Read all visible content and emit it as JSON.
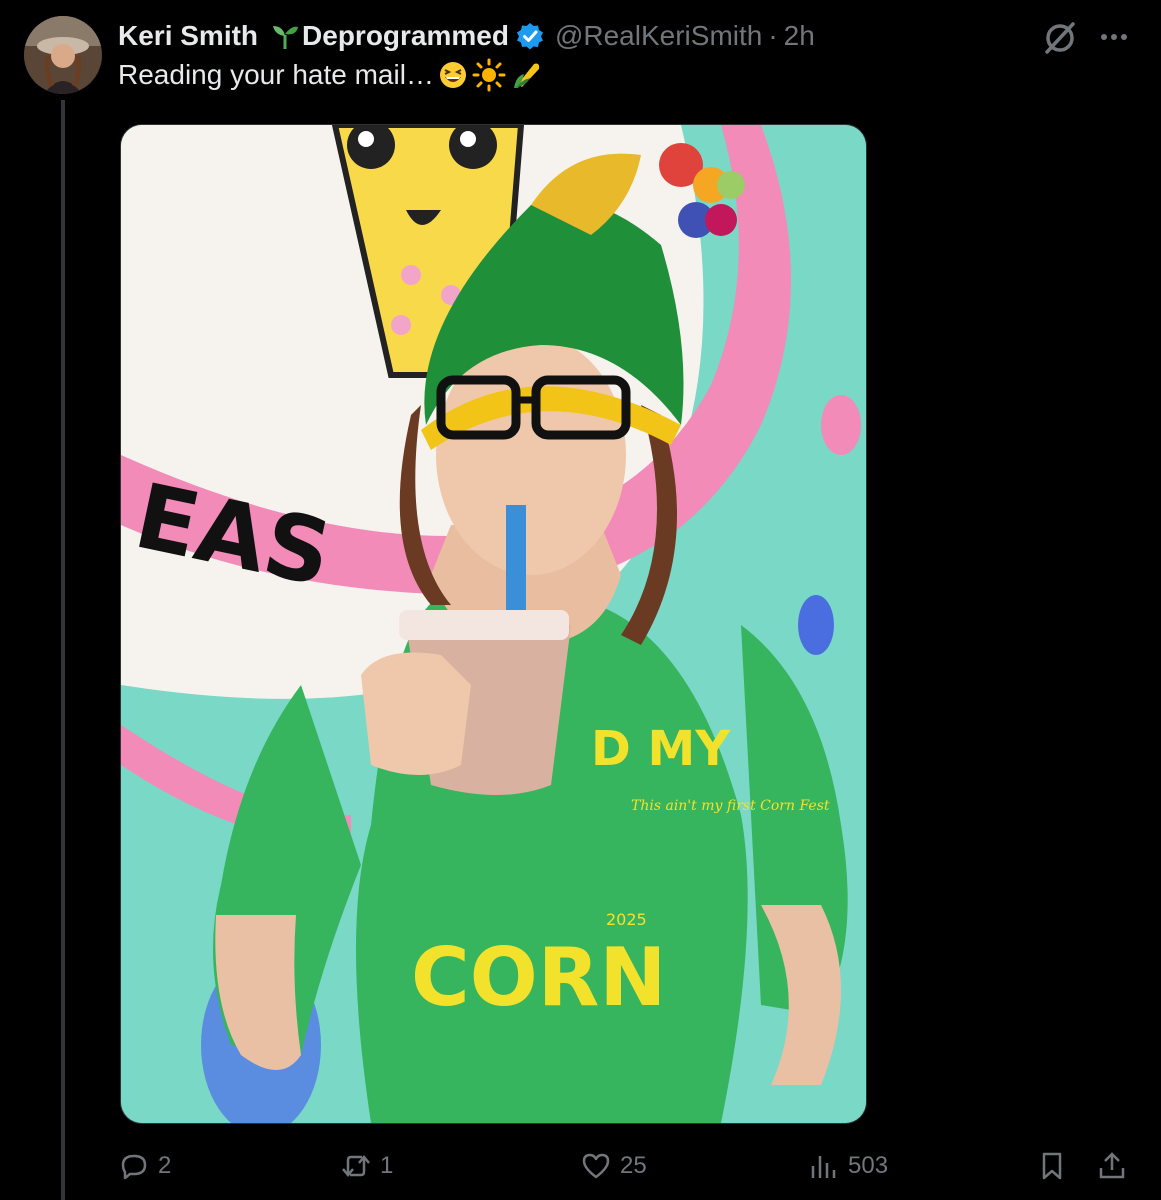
{
  "tweet": {
    "author_name": "Keri Smith",
    "author_suffix": "Deprogrammed",
    "handle": "@RealKeriSmith",
    "separator": "·",
    "time": "2h",
    "text": "Reading your hate mail…",
    "text_emojis": [
      "grinning-squinting-face",
      "sun",
      "corn"
    ]
  },
  "media": {
    "shirt_text_top": "D MY",
    "shirt_text_bottom": "CORN",
    "shirt_small_text": "This ain't my first Corn Fest",
    "shirt_year": "2025",
    "sign_text": "EAS"
  },
  "actions": {
    "replies": "2",
    "reposts": "1",
    "likes": "25",
    "views": "503"
  },
  "colors": {
    "background": "#000000",
    "text": "#e7e9ea",
    "muted": "#71767b",
    "verified": "#1d9bf0"
  }
}
